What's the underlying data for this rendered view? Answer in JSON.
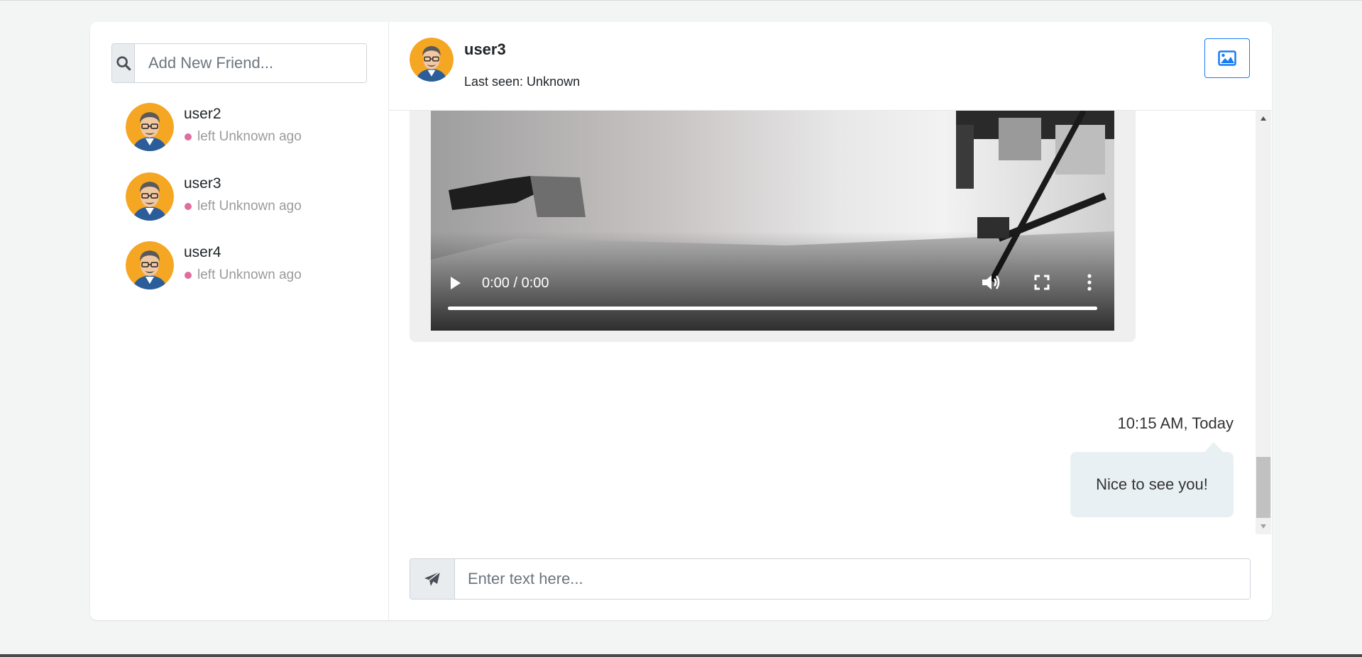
{
  "search": {
    "placeholder": "Add New Friend...",
    "icon": "search-icon"
  },
  "friends": [
    {
      "name": "user2",
      "status": "left Unknown ago",
      "status_color": "#e06d9c"
    },
    {
      "name": "user3",
      "status": "left Unknown ago",
      "status_color": "#e06d9c"
    },
    {
      "name": "user4",
      "status": "left Unknown ago",
      "status_color": "#e06d9c"
    }
  ],
  "chat": {
    "title": "user3",
    "last_seen": "Last seen: Unknown",
    "image_button_icon": "image-icon",
    "accent": "#1a7bf3"
  },
  "messages": {
    "video": {
      "time": "0:00 / 0:00",
      "progress": 1.0
    },
    "text": {
      "time": "10:15 AM, Today",
      "body": "Nice to see you!"
    }
  },
  "composer": {
    "placeholder": "Enter text here...",
    "send_icon": "paper-plane-icon"
  }
}
